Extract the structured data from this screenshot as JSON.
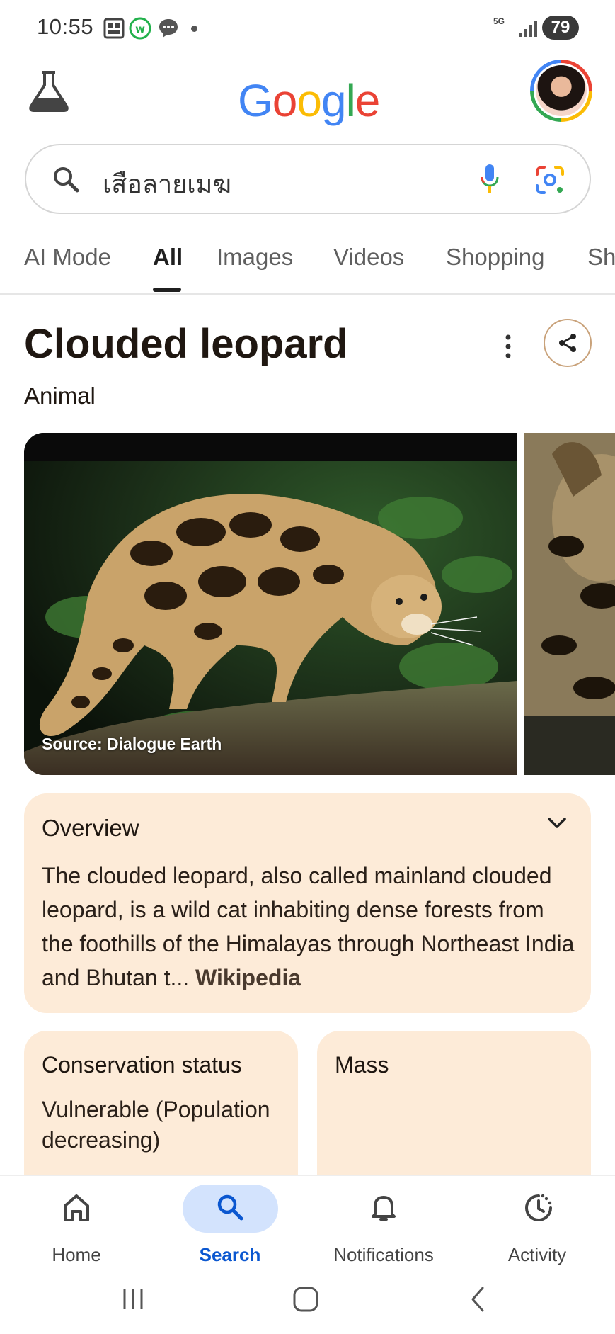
{
  "status_bar": {
    "time": "10:55",
    "network": "5G",
    "battery": "79"
  },
  "header": {
    "logo_letters": [
      "G",
      "o",
      "o",
      "g",
      "l",
      "e"
    ],
    "logo_colors": [
      "#4285f4",
      "#ea4335",
      "#fbbc05",
      "#4285f4",
      "#34a853",
      "#ea4335"
    ]
  },
  "search": {
    "query": "เสือลายเมฆ"
  },
  "tabs": [
    "AI Mode",
    "All",
    "Images",
    "Videos",
    "Shopping",
    "Sh"
  ],
  "active_tab": "All",
  "entity": {
    "title": "Clouded leopard",
    "subtitle": "Animal",
    "image_caption": "Source: Dialogue Earth"
  },
  "overview": {
    "title": "Overview",
    "text": "The clouded leopard, also called mainland clouded leopard, is a wild cat inhabiting dense forests from the foothills of the Himalayas through Northeast India and Bhutan t",
    "ellipsis": "...",
    "source": "Wikipedia"
  },
  "cards": [
    {
      "title": "Conservation status",
      "value": "Vulnerable (Population decreasing)"
    },
    {
      "title": "Mass",
      "value": ""
    }
  ],
  "bottom_nav": [
    {
      "label": "Home",
      "icon": "home-icon"
    },
    {
      "label": "Search",
      "icon": "search-icon"
    },
    {
      "label": "Notifications",
      "icon": "bell-icon"
    },
    {
      "label": "Activity",
      "icon": "activity-icon"
    }
  ],
  "colors": {
    "accent": "#0b57d0",
    "card_bg": "#fdebd8",
    "nav_pill": "#d3e3fd"
  }
}
